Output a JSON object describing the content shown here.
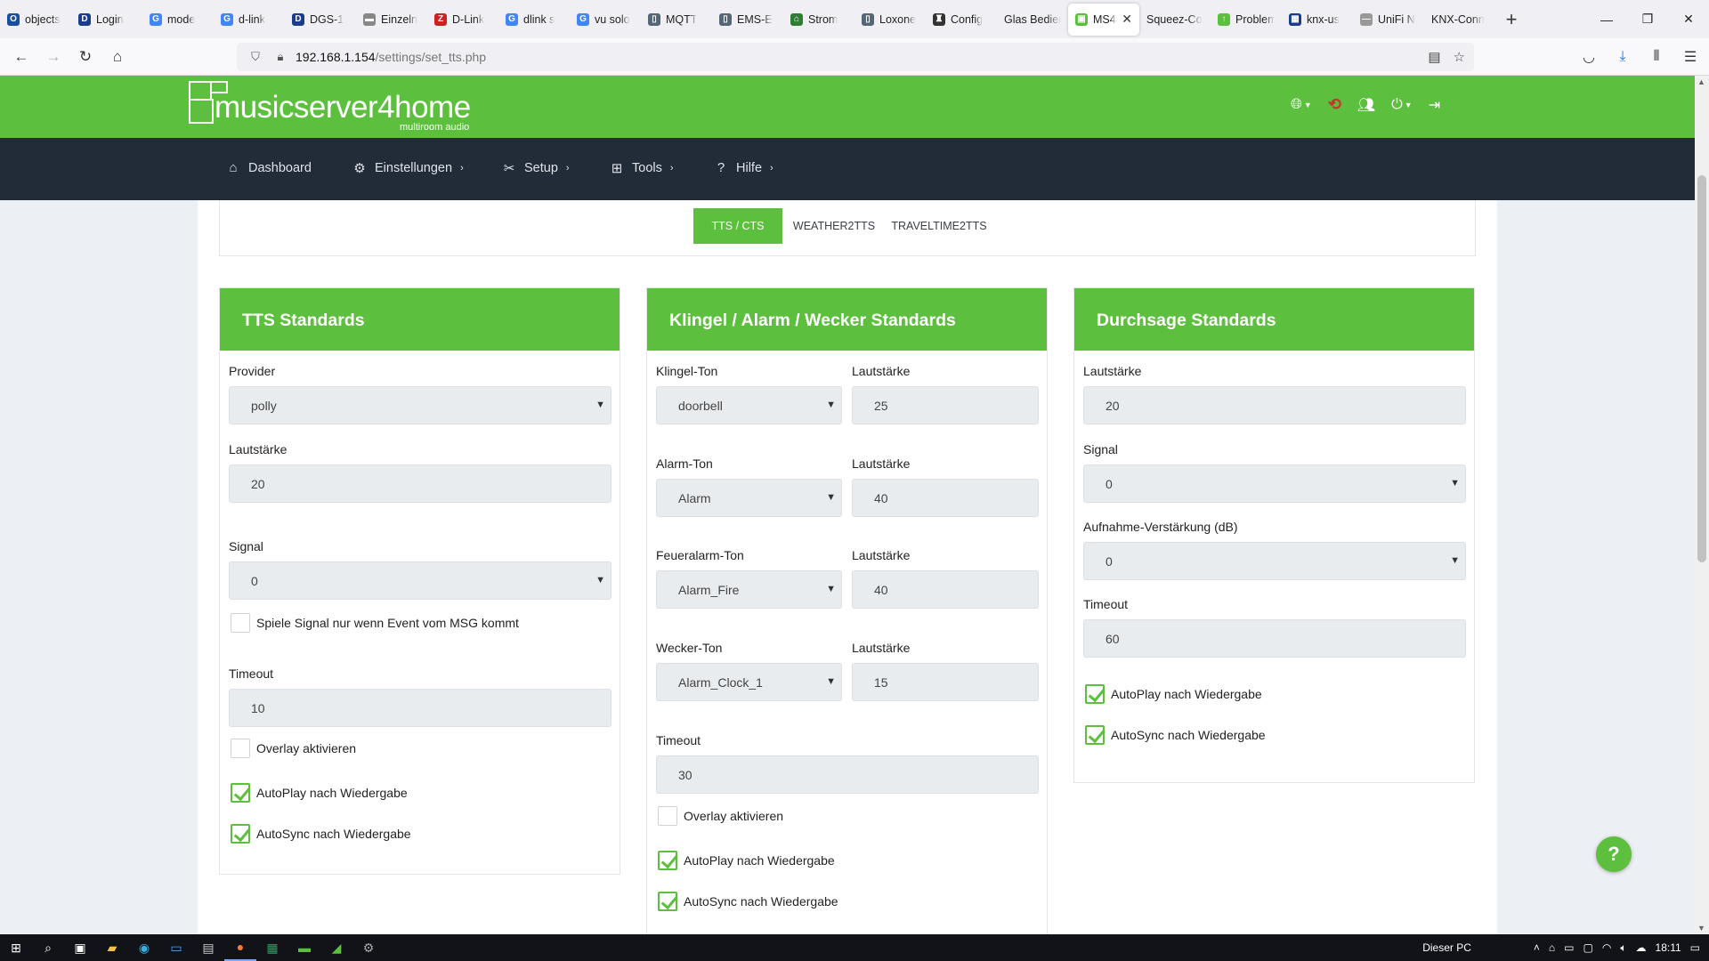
{
  "browser": {
    "tabs": [
      {
        "label": "objects",
        "color": "#1a4fa0",
        "glyph": "O"
      },
      {
        "label": "Login",
        "color": "#1a3c8a",
        "glyph": "D"
      },
      {
        "label": "mode",
        "color": "#4285f4",
        "glyph": "G"
      },
      {
        "label": "d-link",
        "color": "#4285f4",
        "glyph": "G"
      },
      {
        "label": "DGS-1",
        "color": "#1a3c8a",
        "glyph": "D"
      },
      {
        "label": "Einzeln",
        "color": "#888888",
        "glyph": "▬"
      },
      {
        "label": "D-Link",
        "color": "#cc2222",
        "glyph": "Z"
      },
      {
        "label": "dlink s",
        "color": "#4285f4",
        "glyph": "G"
      },
      {
        "label": "vu solo",
        "color": "#4285f4",
        "glyph": "G"
      },
      {
        "label": "MQTT",
        "color": "#556677",
        "glyph": "▯"
      },
      {
        "label": "EMS-E",
        "color": "#556677",
        "glyph": "▯"
      },
      {
        "label": "Strom",
        "color": "#2e7d32",
        "glyph": "⌂"
      },
      {
        "label": "Loxone",
        "color": "#556677",
        "glyph": "▯"
      },
      {
        "label": "Config",
        "color": "#333333",
        "glyph": "♜"
      },
      {
        "label": "Glas Bedien",
        "color": "#ffffff",
        "glyph": ""
      },
      {
        "label": "MS4",
        "color": "#5cbf3d",
        "glyph": "▣",
        "active": true
      },
      {
        "label": "Squeez-Co",
        "color": "#ffffff",
        "glyph": ""
      },
      {
        "label": "Problem",
        "color": "#5cbf3d",
        "glyph": "↑"
      },
      {
        "label": "knx-us",
        "color": "#1a3c8a",
        "glyph": "▦"
      },
      {
        "label": "UniFi N",
        "color": "#999999",
        "glyph": "—"
      },
      {
        "label": "KNX-Conn",
        "color": "#ffffff",
        "glyph": ""
      }
    ],
    "url_host": "192.168.1.154",
    "url_path": "/settings/set_tts.php"
  },
  "site": {
    "logo_text": "musicserver4home",
    "logo_sub": "multiroom audio"
  },
  "menu": {
    "dashboard": "Dashboard",
    "einstellungen": "Einstellungen",
    "setup": "Setup",
    "tools": "Tools",
    "hilfe": "Hilfe"
  },
  "subtabs": {
    "tts": "TTS / CTS",
    "weather": "WEATHER2TTS",
    "travel": "TRAVELTIME2TTS"
  },
  "tts": {
    "title": "TTS Standards",
    "provider_label": "Provider",
    "provider_value": "polly",
    "volume_label": "Lautstärke",
    "volume_value": "20",
    "signal_label": "Signal",
    "signal_value": "0",
    "msg_only_label": "Spiele Signal nur wenn Event vom MSG kommt",
    "timeout_label": "Timeout",
    "timeout_value": "10",
    "overlay_label": "Overlay aktivieren",
    "autoplay_label": "AutoPlay nach Wiedergabe",
    "autosync_label": "AutoSync nach Wiedergabe"
  },
  "alarm": {
    "title": "Klingel / Alarm / Wecker Standards",
    "doorbell_label": "Klingel-Ton",
    "doorbell_value": "doorbell",
    "doorbell_vol_label": "Lautstärke",
    "doorbell_vol": "25",
    "alarm_label": "Alarm-Ton",
    "alarm_value": "Alarm",
    "alarm_vol_label": "Lautstärke",
    "alarm_vol": "40",
    "fire_label": "Feueralarm-Ton",
    "fire_value": "Alarm_Fire",
    "fire_vol_label": "Lautstärke",
    "fire_vol": "40",
    "clock_label": "Wecker-Ton",
    "clock_value": "Alarm_Clock_1",
    "clock_vol_label": "Lautstärke",
    "clock_vol": "15",
    "timeout_label": "Timeout",
    "timeout_value": "30",
    "overlay_label": "Overlay aktivieren",
    "autoplay_label": "AutoPlay nach Wiedergabe",
    "autosync_label": "AutoSync nach Wiedergabe"
  },
  "announce": {
    "title": "Durchsage Standards",
    "volume_label": "Lautstärke",
    "volume_value": "20",
    "signal_label": "Signal",
    "signal_value": "0",
    "gain_label": "Aufnahme-Verstärkung (dB)",
    "gain_value": "0",
    "timeout_label": "Timeout",
    "timeout_value": "60",
    "autoplay_label": "AutoPlay nach Wiedergabe",
    "autosync_label": "AutoSync nach Wiedergabe"
  },
  "checkbox_states": {
    "tts_msg_only": false,
    "tts_overlay": false,
    "tts_autoplay": true,
    "tts_autosync": true,
    "alarm_overlay": false,
    "alarm_autoplay": true,
    "alarm_autosync": true,
    "announce_autoplay": true,
    "announce_autosync": true
  },
  "help_fab": "?",
  "taskbar": {
    "location": "Dieser PC",
    "time": "18:11"
  },
  "colors": {
    "brand_green": "#5cbf3d",
    "menu_dark": "#222b38",
    "sync_red": "#c0392b"
  }
}
